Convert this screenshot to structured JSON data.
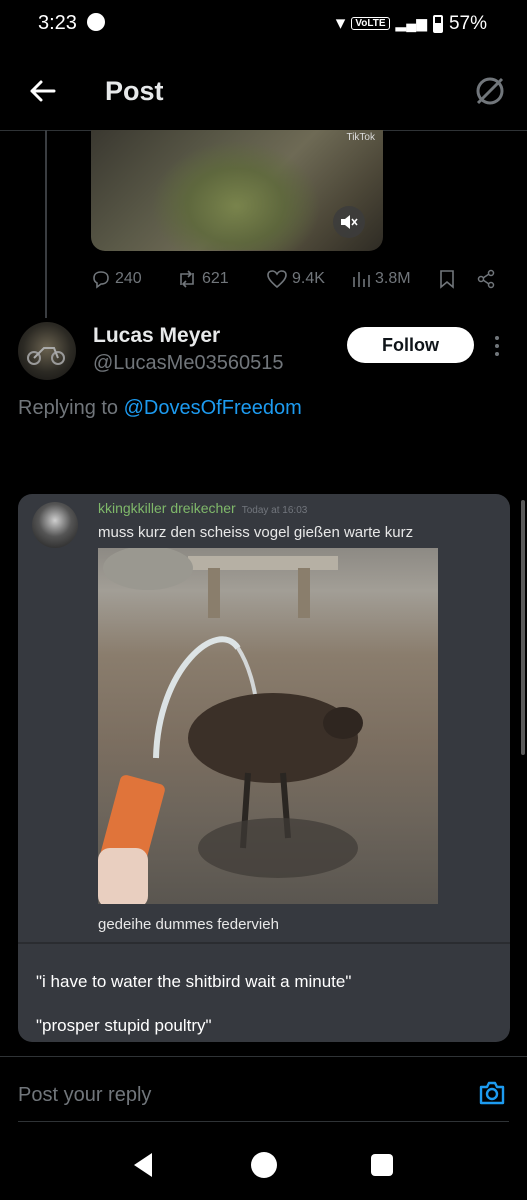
{
  "status_bar": {
    "time": "3:23",
    "network": "VoLTE",
    "battery": "57%"
  },
  "header": {
    "title": "Post"
  },
  "video": {
    "watermark": "TikTok"
  },
  "post_actions": {
    "replies": "240",
    "reposts": "621",
    "likes": "9.4K",
    "views": "3.8M"
  },
  "author": {
    "name": "Lucas Meyer",
    "handle": "@LucasMe03560515",
    "follow_label": "Follow"
  },
  "replying": {
    "prefix": "Replying to",
    "mention": "@DovesOfFreedom"
  },
  "embedded": {
    "username": "kkingkkiller dreikecher",
    "timestamp": "Today at 16:03",
    "message": "muss kurz den scheiss vogel gießen warte kurz",
    "caption": "gedeihe dummes federvieh",
    "translation_1": "\"i have to water the shitbird wait a minute\"",
    "translation_2": "\"prosper stupid poultry\""
  },
  "composer": {
    "placeholder": "Post your reply"
  },
  "colors": {
    "accent": "#1d9bf0",
    "background": "#000000",
    "muted": "#71767b",
    "discord_bg": "#36393f",
    "discord_user": "#7fb86a"
  },
  "icons": [
    "back-arrow-icon",
    "grok-icon",
    "mute-icon",
    "reply-icon",
    "repost-icon",
    "like-icon",
    "views-icon",
    "bookmark-icon",
    "share-icon",
    "more-icon",
    "camera-icon"
  ]
}
